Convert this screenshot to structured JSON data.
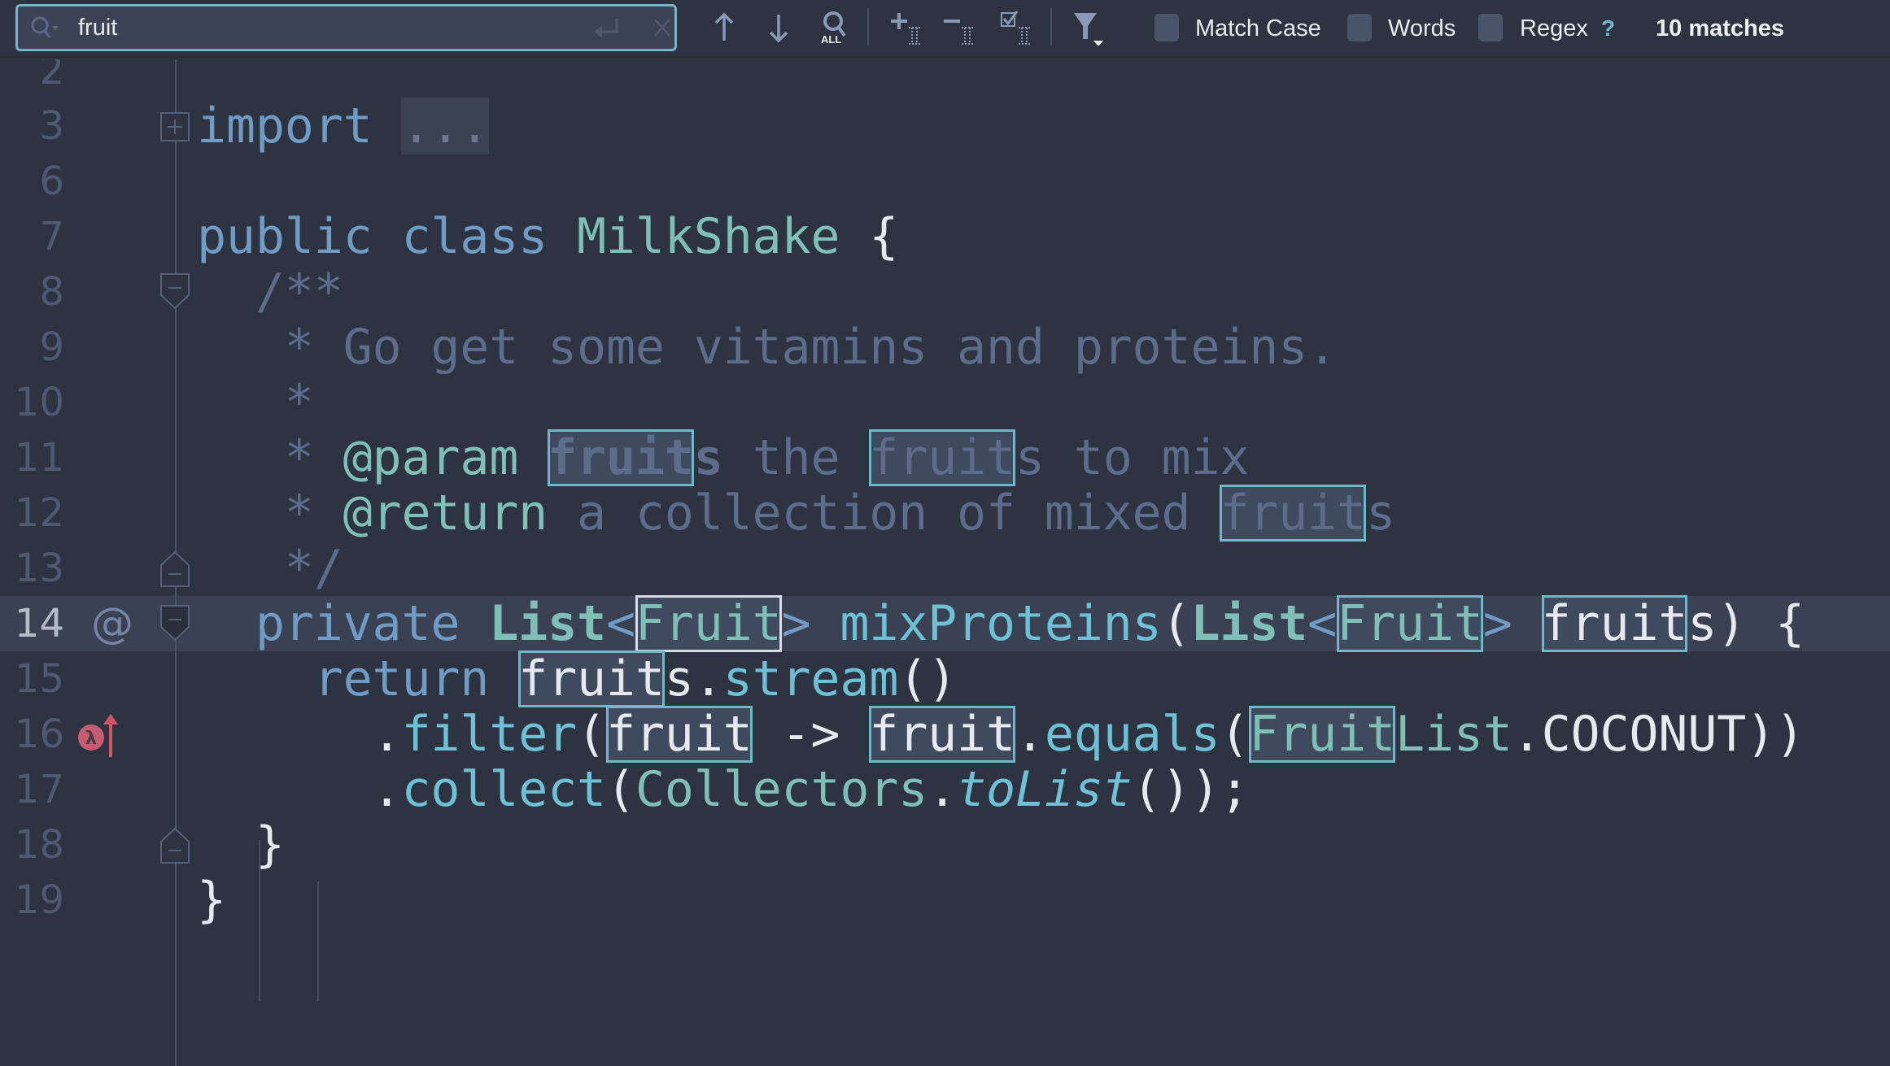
{
  "find_bar": {
    "query": "fruit",
    "search_icon": "search-history-icon",
    "enter_icon": "enter-icon",
    "clear_icon": "clear-icon",
    "buttons": [
      {
        "name": "previous-occurrence",
        "icon": "arrow-up-icon"
      },
      {
        "name": "next-occurrence",
        "icon": "arrow-down-icon"
      },
      {
        "name": "find-all",
        "icon": "find-all-icon",
        "label": "ALL"
      },
      {
        "name": "add-selection-next",
        "icon": "add-occurrence-icon"
      },
      {
        "name": "unselect-occurrence",
        "icon": "remove-occurrence-icon"
      },
      {
        "name": "select-all-occurrences",
        "icon": "select-all-occurrences-icon"
      },
      {
        "name": "filter-search-results",
        "icon": "filter-icon"
      }
    ],
    "options": [
      {
        "label": "Match Case",
        "checked": false
      },
      {
        "label": "Words",
        "checked": false
      },
      {
        "label": "Regex",
        "checked": false
      }
    ],
    "regex_help": "?",
    "match_count": "10 matches"
  },
  "editor": {
    "current_line": 14,
    "colors": {
      "background": "#2d3340",
      "current_line": "#3a4152",
      "match_border": "#6fb7c9",
      "current_match_border": "#d7dde6",
      "keyword": "#6f9bc4",
      "type": "#7fbfb7",
      "comment": "#5c6c8a",
      "method": "#6ec0d4"
    },
    "lines": [
      {
        "num": "2",
        "tokens": []
      },
      {
        "num": "3",
        "fold": "expand",
        "tokens": [
          {
            "t": "import",
            "c": "kw"
          },
          {
            "t": " "
          },
          {
            "t": "...",
            "c": "fold"
          }
        ]
      },
      {
        "num": "6",
        "tokens": []
      },
      {
        "num": "7",
        "tokens": [
          {
            "t": "public class ",
            "c": "kw"
          },
          {
            "t": "MilkShake",
            "c": "type"
          },
          {
            "t": " {",
            "c": "pl"
          }
        ]
      },
      {
        "num": "8",
        "fold": "collapse-start",
        "tokens": [
          {
            "t": "  /**",
            "c": "cm"
          }
        ]
      },
      {
        "num": "9",
        "tokens": [
          {
            "t": "   * Go get some vitamins and proteins.",
            "c": "cm"
          }
        ]
      },
      {
        "num": "10",
        "tokens": [
          {
            "t": "   *",
            "c": "cm"
          }
        ]
      },
      {
        "num": "11",
        "tokens": [
          {
            "t": "   * ",
            "c": "cm"
          },
          {
            "t": "@param",
            "c": "doc"
          },
          {
            "t": " ",
            "c": "cm"
          },
          {
            "t": "fruit",
            "c": "cm bold",
            "hit": true
          },
          {
            "t": "s",
            "c": "cm bold"
          },
          {
            "t": " the ",
            "c": "cm"
          },
          {
            "t": "fruit",
            "c": "cm",
            "hit": true
          },
          {
            "t": "s to mix",
            "c": "cm"
          }
        ]
      },
      {
        "num": "12",
        "tokens": [
          {
            "t": "   * ",
            "c": "cm"
          },
          {
            "t": "@return",
            "c": "doc"
          },
          {
            "t": " a collection of mixed ",
            "c": "cm"
          },
          {
            "t": "fruit",
            "c": "cm",
            "hit": true
          },
          {
            "t": "s",
            "c": "cm"
          }
        ]
      },
      {
        "num": "13",
        "fold": "collapse-end",
        "tokens": [
          {
            "t": "   */",
            "c": "cm"
          }
        ]
      },
      {
        "num": "14",
        "fold": "collapse-start",
        "marker": "at-sign",
        "tokens": [
          {
            "t": "  private ",
            "c": "kw"
          },
          {
            "t": "List",
            "c": "type bold"
          },
          {
            "t": "<",
            "c": "kw"
          },
          {
            "t": "Fruit",
            "c": "type",
            "hit": true,
            "current": true
          },
          {
            "t": ">",
            "c": "kw"
          },
          {
            "t": " "
          },
          {
            "t": "mixProteins",
            "c": "fn"
          },
          {
            "t": "(",
            "c": "pl"
          },
          {
            "t": "List",
            "c": "type bold"
          },
          {
            "t": "<",
            "c": "kw"
          },
          {
            "t": "Fruit",
            "c": "type",
            "hit": true
          },
          {
            "t": ">",
            "c": "kw"
          },
          {
            "t": " "
          },
          {
            "t": "fruit",
            "c": "pl",
            "hit": true
          },
          {
            "t": "s) {",
            "c": "pl"
          }
        ]
      },
      {
        "num": "15",
        "tokens": [
          {
            "t": "    return ",
            "c": "kw"
          },
          {
            "t": "fruit",
            "c": "pl",
            "hit": true
          },
          {
            "t": "s",
            "c": "pl"
          },
          {
            "t": ".",
            "c": "pl"
          },
          {
            "t": "stream",
            "c": "fn"
          },
          {
            "t": "()",
            "c": "pl"
          }
        ]
      },
      {
        "num": "16",
        "marker": "lambda-up",
        "tokens": [
          {
            "t": "      .",
            "c": "pl"
          },
          {
            "t": "filter",
            "c": "fn"
          },
          {
            "t": "(",
            "c": "pl"
          },
          {
            "t": "fruit",
            "c": "pl",
            "hit": true
          },
          {
            "t": " -> ",
            "c": "pl"
          },
          {
            "t": "fruit",
            "c": "pl",
            "hit": true
          },
          {
            "t": ".",
            "c": "pl"
          },
          {
            "t": "equals",
            "c": "fn"
          },
          {
            "t": "(",
            "c": "pl"
          },
          {
            "t": "Fruit",
            "c": "type",
            "hit": true
          },
          {
            "t": "List",
            "c": "type"
          },
          {
            "t": ".COCONUT))",
            "c": "pl"
          }
        ]
      },
      {
        "num": "17",
        "tokens": [
          {
            "t": "      .",
            "c": "pl"
          },
          {
            "t": "collect",
            "c": "fn"
          },
          {
            "t": "(",
            "c": "pl"
          },
          {
            "t": "Collectors",
            "c": "type"
          },
          {
            "t": ".",
            "c": "pl"
          },
          {
            "t": "toList",
            "c": "it"
          },
          {
            "t": "());",
            "c": "pl"
          }
        ]
      },
      {
        "num": "18",
        "fold": "collapse-end",
        "tokens": [
          {
            "t": "  }",
            "c": "pl"
          }
        ]
      },
      {
        "num": "19",
        "tokens": [
          {
            "t": "}",
            "c": "pl"
          }
        ]
      }
    ]
  }
}
